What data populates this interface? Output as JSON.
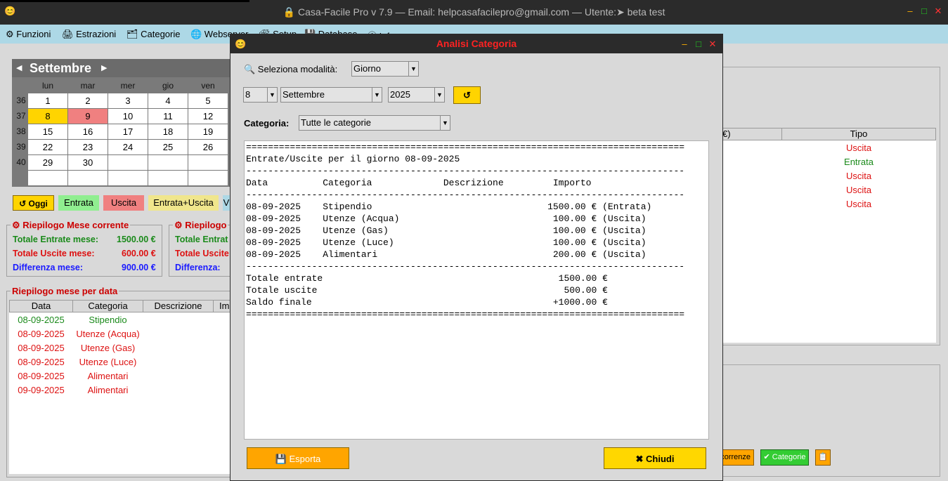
{
  "window": {
    "title": "🔒 Casa-Facile Pro v 7.9  — Email: helpcasafacilepro@gmail.com —  Utente:➤ beta test",
    "app_icon": "😊",
    "min": "–",
    "max": "□",
    "close": "✕"
  },
  "menu": [
    {
      "label": "⚙ Funzioni"
    },
    {
      "label": "🖨 Estrazioni"
    },
    {
      "label": "🗂 Categorie"
    },
    {
      "label": "🌐 Webserver"
    },
    {
      "label": "🛠 Setup"
    },
    {
      "label": "💾 Database"
    },
    {
      "label": "ⓘ Info"
    }
  ],
  "calendar": {
    "month": "Settembre",
    "prev": "◀",
    "next": "▶",
    "day_names": [
      "lun",
      "mar",
      "mer",
      "gio",
      "ven"
    ],
    "weeks": [
      {
        "num": "36",
        "days": [
          "1",
          "2",
          "3",
          "4",
          "5"
        ]
      },
      {
        "num": "37",
        "days": [
          "8",
          "9",
          "10",
          "11",
          "12"
        ]
      },
      {
        "num": "38",
        "days": [
          "15",
          "16",
          "17",
          "18",
          "19"
        ]
      },
      {
        "num": "39",
        "days": [
          "22",
          "23",
          "24",
          "25",
          "26"
        ]
      },
      {
        "num": "40",
        "days": [
          "29",
          "30",
          "",
          "",
          ""
        ]
      },
      {
        "num": "",
        "days": [
          "",
          "",
          "",
          "",
          ""
        ]
      }
    ],
    "today_color": "#ffd400",
    "selected_color": "#f08080"
  },
  "legend": {
    "oggi": "↺ Oggi",
    "entrata": "Entrata",
    "uscita": "Uscita",
    "entrata_uscita": "Entrata+Uscita",
    "extra": "V"
  },
  "riepilogo_corrente": {
    "title": "⚙ Riepilogo Mese corrente",
    "entrate_label": "Totale Entrate mese:",
    "entrate_value": "1500.00 €",
    "uscite_label": "Totale Uscite mese:",
    "uscite_value": "600.00 €",
    "diff_label": "Differenza mese:",
    "diff_value": "900.00 €"
  },
  "riepilogo_second": {
    "title": "⚙ Riepilogo",
    "entrate_label": "Totale Entrat",
    "uscite_label": "Totale Uscite",
    "diff_label": "Differenza:"
  },
  "riepilogo_data": {
    "title": "Riepilogo mese per data",
    "columns": [
      "Data",
      "Categoria",
      "Descrizione",
      "Im"
    ],
    "rows": [
      {
        "data": "08-09-2025",
        "categoria": "Stipendio",
        "color": "#1a8a1a"
      },
      {
        "data": "08-09-2025",
        "categoria": "Utenze (Acqua)",
        "color": "#dd1111"
      },
      {
        "data": "08-09-2025",
        "categoria": "Utenze (Gas)",
        "color": "#dd1111"
      },
      {
        "data": "08-09-2025",
        "categoria": "Utenze (Luce)",
        "color": "#dd1111"
      },
      {
        "data": "08-09-2025",
        "categoria": "Alimentari",
        "color": "#dd1111"
      },
      {
        "data": "09-09-2025",
        "categoria": "Alimentari",
        "color": "#dd1111"
      }
    ]
  },
  "right_table": {
    "col_left": "€)",
    "col_tipo": "Tipo",
    "rows": [
      {
        "tipo": "Uscita",
        "color": "#dd1111"
      },
      {
        "tipo": "Entrata",
        "color": "#1a8a1a"
      },
      {
        "tipo": "Uscita",
        "color": "#dd1111"
      },
      {
        "tipo": "Uscita",
        "color": "#dd1111"
      },
      {
        "tipo": "Uscita",
        "color": "#dd1111"
      }
    ]
  },
  "bottom_buttons": {
    "ricorrenze": "correnze",
    "categorie": "✔ Categorie",
    "extra": "📋"
  },
  "dialog": {
    "title": "Analisi Categoria",
    "icon": "😊",
    "min": "–",
    "max": "□",
    "close": "✕",
    "mode_label": "🔍 Seleziona modalità:",
    "mode_value": "Giorno",
    "day_value": "8",
    "month_value": "Settembre",
    "year_value": "2025",
    "refresh": "↺",
    "category_label": "Categoria:",
    "category_value": "Tutte le categorie",
    "report_lines": [
      "================================================================================",
      "Entrate/Uscite per il giorno 08-09-2025",
      "--------------------------------------------------------------------------------",
      "Data          Categoria             Descrizione         Importo",
      "--------------------------------------------------------------------------------",
      "08-09-2025    Stipendio                                1500.00 € (Entrata)",
      "08-09-2025    Utenze (Acqua)                            100.00 € (Uscita)",
      "08-09-2025    Utenze (Gas)                              100.00 € (Uscita)",
      "08-09-2025    Utenze (Luce)                             100.00 € (Uscita)",
      "08-09-2025    Alimentari                                200.00 € (Uscita)",
      "--------------------------------------------------------------------------------",
      "Totale entrate                                           1500.00 €",
      "Totale uscite                                             500.00 €",
      "Saldo finale                                            +1000.00 €",
      "================================================================================"
    ],
    "export_button": "💾 Esporta",
    "close_button": "✖ Chiudi"
  },
  "colors": {
    "menubar": "#add8e6",
    "entrata_green": "#90ee90",
    "uscita_red": "#f08080",
    "entrata_uscita": "#f0e68c",
    "export_orange": "#ffa500",
    "close_yellow": "#ffd700",
    "dialog_title": "#ff2222"
  }
}
